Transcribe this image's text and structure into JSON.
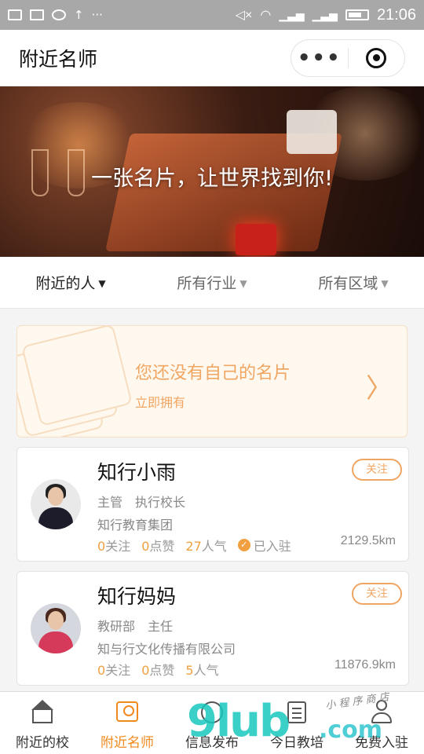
{
  "status_bar": {
    "time": "21:06",
    "extra": "···"
  },
  "nav": {
    "title": "附近名师",
    "more_label": "•••"
  },
  "banner": {
    "slogan": "一张名片，让世界找到你!"
  },
  "filters": [
    {
      "label": "附近的人"
    },
    {
      "label": "所有行业"
    },
    {
      "label": "所有区域"
    }
  ],
  "promo": {
    "title": "您还没有自己的名片",
    "subtitle": "立即拥有",
    "arrow": "〉"
  },
  "cards": [
    {
      "name": "知行小雨",
      "follow_label": "关注",
      "department": "主管",
      "position": "执行校长",
      "org": "知行教育集团",
      "follows": "0",
      "follows_label": "关注",
      "likes": "0",
      "likes_label": "点赞",
      "popularity": "27",
      "popularity_label": "人气",
      "verified_label": "已入驻",
      "distance": "2129.5km"
    },
    {
      "name": "知行妈妈",
      "follow_label": "关注",
      "department": "教研部",
      "position": "主任",
      "org": "知与行文化传播有限公司",
      "follows": "0",
      "follows_label": "关注",
      "likes": "0",
      "likes_label": "点赞",
      "popularity": "5",
      "popularity_label": "人气",
      "distance": "11876.9km"
    }
  ],
  "tabs": [
    {
      "label": "附近的校",
      "icon": "home-icon"
    },
    {
      "label": "附近名师",
      "icon": "card-icon",
      "active": true
    },
    {
      "label": "信息发布",
      "icon": "compass-icon"
    },
    {
      "label": "今日教培",
      "icon": "list-icon"
    },
    {
      "label": "免费入驻",
      "icon": "user-icon"
    }
  ],
  "watermark": {
    "big": "9lub",
    "com": ".com",
    "small": "小 程 序 商 店"
  },
  "colors": {
    "accent": "#f08a1e",
    "promo_text": "#f0a663",
    "number": "#f0a040"
  }
}
